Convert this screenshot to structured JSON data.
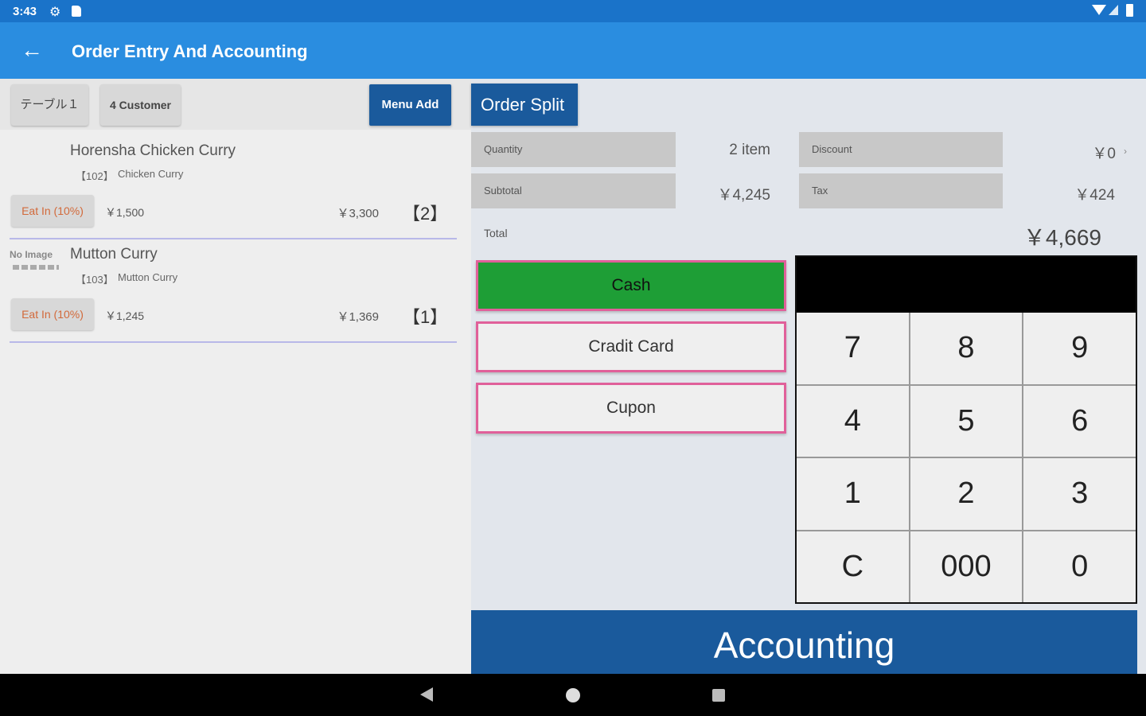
{
  "status": {
    "time": "3:43"
  },
  "appbar": {
    "title": "Order Entry And Accounting"
  },
  "left": {
    "table_chip": "テーブル１",
    "customer_chip": "4 Customer",
    "menu_add": "Menu Add",
    "items": [
      {
        "no_image": "",
        "name": "Horensha Chicken Curry",
        "code": "【102】",
        "sub": "Chicken Curry",
        "eat_in": "Eat In (10%)",
        "unit_price": "￥1,500",
        "line_price": "￥3,300",
        "qty": "【2】"
      },
      {
        "no_image": "No Image",
        "name": "Mutton Curry",
        "code": "【103】",
        "sub": "Mutton Curry",
        "eat_in": "Eat In (10%)",
        "unit_price": "￥1,245",
        "line_price": "￥1,369",
        "qty": "【1】"
      }
    ]
  },
  "right": {
    "order_split": "Order Split",
    "quantity_label": "Quantity",
    "quantity_value": "2 item",
    "discount_label": "Discount",
    "discount_value": "￥0",
    "subtotal_label": "Subtotal",
    "subtotal_value": "￥4,245",
    "tax_label": "Tax",
    "tax_value": "￥424",
    "total_label": "Total",
    "total_value": "￥4,669",
    "pay": {
      "cash": "Cash",
      "credit": "Cradit Card",
      "cupon": "Cupon"
    },
    "display_value": "",
    "keys": [
      "7",
      "8",
      "9",
      "4",
      "5",
      "6",
      "1",
      "2",
      "3",
      "C",
      "000",
      "0"
    ],
    "accounting": "Accounting"
  }
}
